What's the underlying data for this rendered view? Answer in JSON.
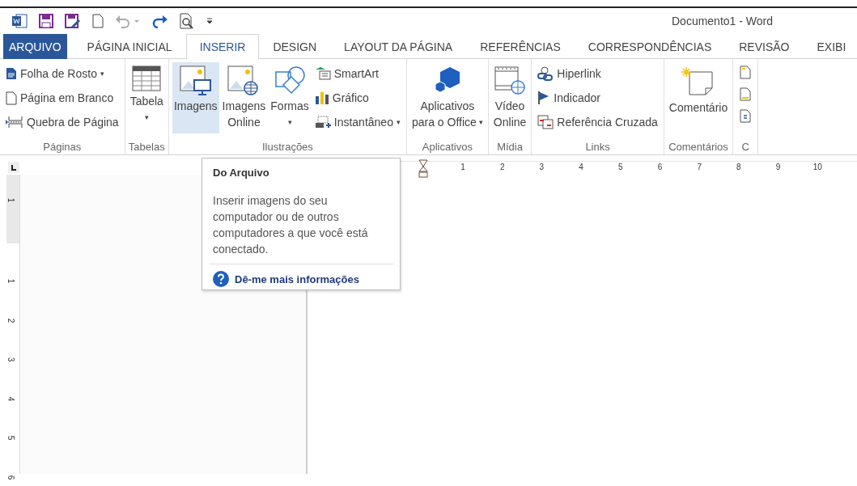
{
  "window": {
    "title": "Documento1 - Word"
  },
  "tabs": [
    {
      "label": "ARQUIVO",
      "kind": "file",
      "selected": false
    },
    {
      "label": "PÁGINA INICIAL",
      "kind": "tab",
      "selected": false
    },
    {
      "label": "INSERIR",
      "kind": "tab",
      "selected": true
    },
    {
      "label": "DESIGN",
      "kind": "tab",
      "selected": false
    },
    {
      "label": "LAYOUT DA PÁGINA",
      "kind": "tab",
      "selected": false
    },
    {
      "label": "REFERÊNCIAS",
      "kind": "tab",
      "selected": false
    },
    {
      "label": "CORRESPONDÊNCIAS",
      "kind": "tab",
      "selected": false
    },
    {
      "label": "REVISÃO",
      "kind": "tab",
      "selected": false
    },
    {
      "label": "EXIBI",
      "kind": "tab",
      "selected": false
    }
  ],
  "ribbon_groups": [
    {
      "label": "Páginas",
      "items": [
        {
          "kind": "stack",
          "buttons": [
            {
              "label": "Folha de Rosto",
              "caret": "▾"
            },
            {
              "label": "Página em Branco"
            },
            {
              "label": "Quebra de Página"
            }
          ]
        }
      ]
    },
    {
      "label": "Tabelas",
      "items": [
        {
          "kind": "large",
          "lines": [
            "Tabela"
          ],
          "caret_below": "▾",
          "selected": false
        }
      ]
    },
    {
      "label": "Ilustrações",
      "items": [
        {
          "kind": "large",
          "lines": [
            "Imagens"
          ],
          "selected": true
        },
        {
          "kind": "large",
          "lines": [
            "Imagens",
            "Online"
          ],
          "selected": false
        },
        {
          "kind": "large",
          "lines": [
            "Formas"
          ],
          "caret_below": "▾",
          "selected": false
        },
        {
          "kind": "stack",
          "buttons": [
            {
              "label": "SmartArt"
            },
            {
              "label": "Gráfico"
            },
            {
              "label": "Instantâneo",
              "caret": "▾"
            }
          ]
        }
      ]
    },
    {
      "label": "Aplicativos",
      "items": [
        {
          "kind": "large",
          "lines": [
            "Aplicativos",
            "para o Office"
          ],
          "caret": "▾",
          "selected": false
        }
      ]
    },
    {
      "label": "Mídia",
      "items": [
        {
          "kind": "large",
          "lines": [
            "Vídeo",
            "Online"
          ],
          "selected": false
        }
      ]
    },
    {
      "label": "Links",
      "items": [
        {
          "kind": "stack",
          "buttons": [
            {
              "label": "Hiperlink"
            },
            {
              "label": "Indicador"
            },
            {
              "label": "Referência Cruzada"
            }
          ]
        }
      ]
    },
    {
      "label": "Comentários",
      "items": [
        {
          "kind": "large",
          "lines": [
            "Comentário"
          ],
          "selected": false
        }
      ]
    },
    {
      "label": "C",
      "items": [
        {
          "kind": "icons"
        }
      ]
    }
  ],
  "tooltip": {
    "title": "Do Arquivo",
    "text": "Inserir imagens do seu computador ou de outros computadores a que você está conectado.",
    "link": "Dê-me mais informações"
  },
  "horizontal_ruler": [
    "1",
    "2",
    "3",
    "4",
    "5",
    "6",
    "7",
    "8",
    "9",
    "10"
  ],
  "vertical_ruler": [
    "1",
    "1",
    "2",
    "3",
    "4",
    "5",
    "6"
  ]
}
